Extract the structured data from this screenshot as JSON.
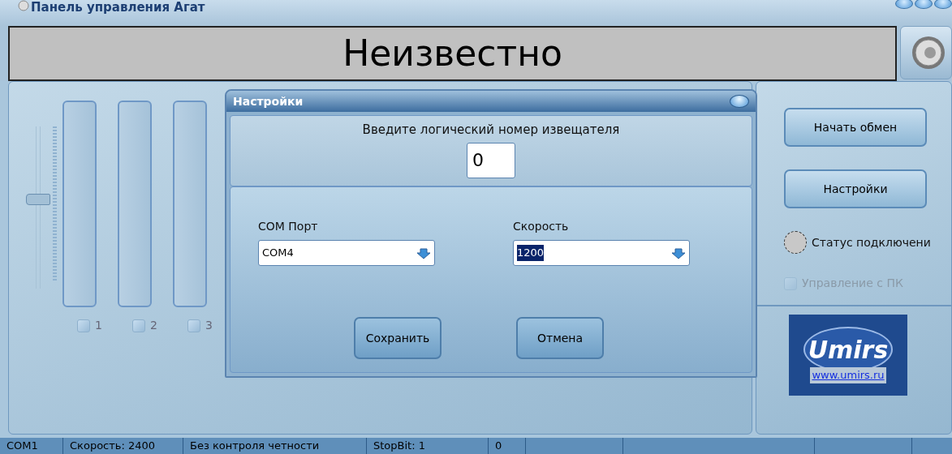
{
  "window": {
    "title": "Панель управления Агат"
  },
  "display": {
    "text": "Неизвестно"
  },
  "slider": {
    "level": 0.55
  },
  "channels": [
    {
      "label": "1",
      "checked": false
    },
    {
      "label": "2",
      "checked": false
    },
    {
      "label": "3",
      "checked": false
    }
  ],
  "actions": [
    "Начать обмен",
    "Настройки"
  ],
  "connection_status": {
    "label": "Статус подключени",
    "on": false
  },
  "pc_control": {
    "label": "Управление с ПК",
    "checked": false,
    "disabled": true
  },
  "logo": {
    "text": "Umirs",
    "url": "www.umirs.ru"
  },
  "dialog": {
    "title": "Настройки",
    "prompt": "Введите логический номер извещателя",
    "number_value": "0",
    "fields": [
      {
        "label": "COM Порт",
        "value": "COM4",
        "highlighted": false
      },
      {
        "label": "Скорость",
        "value": "1200",
        "highlighted": true
      }
    ],
    "buttons": [
      "Сохранить",
      "Отмена"
    ]
  },
  "status_bar": [
    "COM1",
    "Скорость: 2400",
    "Без контроля четности",
    "StopBit: 1",
    "0"
  ]
}
